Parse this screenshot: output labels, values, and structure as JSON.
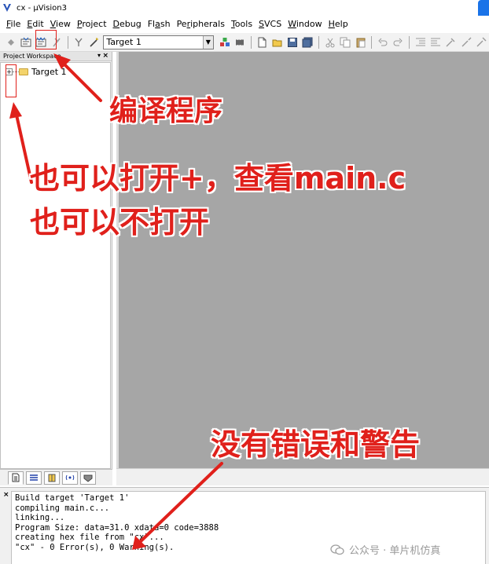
{
  "window": {
    "title": "cx - µVision3"
  },
  "menu": [
    {
      "acc": "F",
      "rest": "ile"
    },
    {
      "acc": "E",
      "rest": "dit"
    },
    {
      "acc": "V",
      "rest": "iew"
    },
    {
      "acc": "P",
      "rest": "roject"
    },
    {
      "acc": "D",
      "rest": "ebug"
    },
    {
      "pre": "Fl",
      "acc": "a",
      "rest": "sh"
    },
    {
      "pre": "Pe",
      "acc": "r",
      "rest": "ipherals"
    },
    {
      "acc": "T",
      "rest": "ools"
    },
    {
      "acc": "S",
      "rest": "VCS"
    },
    {
      "acc": "W",
      "rest": "indow"
    },
    {
      "acc": "H",
      "rest": "elp"
    }
  ],
  "toolbar": {
    "target_value": "Target 1"
  },
  "workspace": {
    "title": "Project Workspace",
    "tree_root": "Target 1",
    "pin": "▾",
    "close": "×"
  },
  "output": {
    "close": "×",
    "lines": [
      "Build target 'Target 1'",
      "compiling main.c...",
      "linking...",
      "Program Size: data=31.0 xdata=0 code=3888",
      "creating hex file from \"cx\"...",
      "\"cx\" - 0 Error(s), 0 Warning(s)."
    ]
  },
  "annotations": {
    "compile": "编译程序",
    "open_line1": "也可以打开+，查看main.c",
    "open_line2": "也可以不打开",
    "no_errors": "没有错误和警告",
    "color": "#e0201b"
  },
  "watermark": {
    "text": "公众号 · 单片机仿真"
  }
}
